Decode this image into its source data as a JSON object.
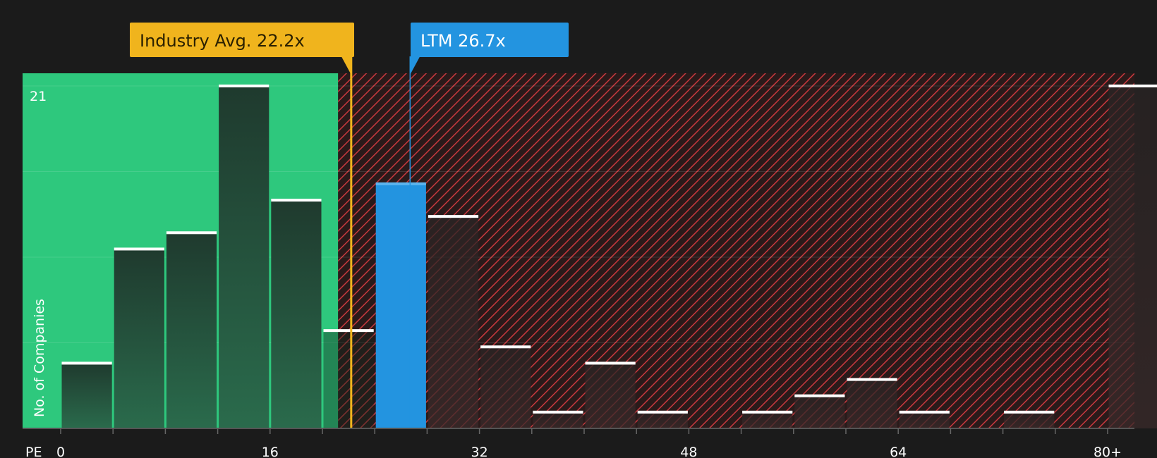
{
  "chart_data": {
    "type": "bar",
    "xlabel": "PE",
    "ylabel": "No. of Companies",
    "x_ticks": [
      "0",
      "16",
      "32",
      "48",
      "64",
      "80+"
    ],
    "x_tick_values": [
      0,
      16,
      32,
      48,
      64,
      80
    ],
    "y_ticks": [
      "21"
    ],
    "xlim": [
      0,
      82
    ],
    "ylim": [
      0,
      21
    ],
    "bin_width": 4,
    "bins": [
      {
        "x0": 0,
        "value": 4
      },
      {
        "x0": 4,
        "value": 11
      },
      {
        "x0": 8,
        "value": 12
      },
      {
        "x0": 12,
        "value": 21
      },
      {
        "x0": 16,
        "value": 14
      },
      {
        "x0": 20,
        "value": 6
      },
      {
        "x0": 24,
        "value": 15,
        "highlight": true
      },
      {
        "x0": 28,
        "value": 13
      },
      {
        "x0": 32,
        "value": 5
      },
      {
        "x0": 36,
        "value": 1
      },
      {
        "x0": 40,
        "value": 4
      },
      {
        "x0": 44,
        "value": 1
      },
      {
        "x0": 52,
        "value": 1
      },
      {
        "x0": 56,
        "value": 2
      },
      {
        "x0": 60,
        "value": 3
      },
      {
        "x0": 64,
        "value": 1
      },
      {
        "x0": 72,
        "value": 1
      },
      {
        "x0": 80,
        "value": 21
      }
    ],
    "fair_zone_end": 21.2,
    "annotations": [
      {
        "label": "Industry Avg. 22.2x",
        "value": 22.2,
        "color": "#f0b41d"
      },
      {
        "label": "LTM 26.7x",
        "value": 26.7,
        "color": "#2394e0"
      }
    ],
    "colors": {
      "background": "#1b1b1b",
      "fair_zone": "#2ec87d",
      "expensive_stripe": "#c8383e",
      "expensive_base": "#2a1a1a",
      "highlight_bar": "#2394e0",
      "bar_cap": "#ffffff"
    }
  }
}
